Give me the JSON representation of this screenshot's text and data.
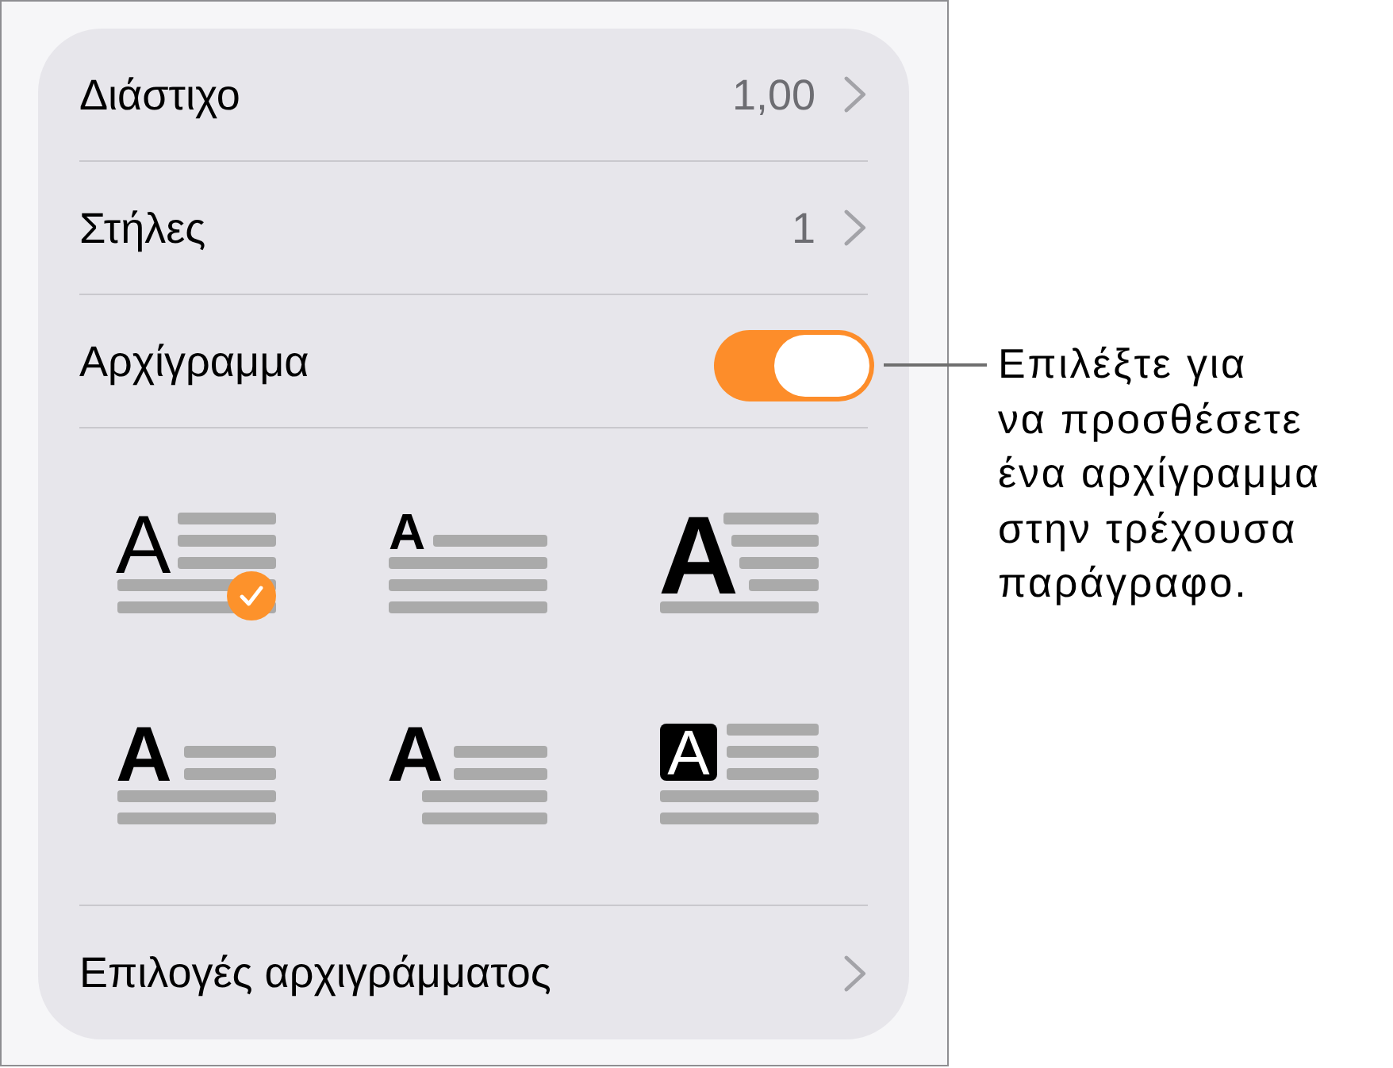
{
  "rows": [
    {
      "label": "Διάστιχο",
      "value": "1,00"
    },
    {
      "label": "Στήλες",
      "value": "1"
    }
  ],
  "drop_cap": {
    "label": "Αρχίγραμμα",
    "on": true
  },
  "drop_cap_styles": [
    {
      "kind": "thin",
      "letter": "A",
      "selected": true
    },
    {
      "kind": "raised",
      "letter": "A",
      "selected": false
    },
    {
      "kind": "tall",
      "letter": "A",
      "selected": false
    },
    {
      "kind": "bold",
      "letter": "A",
      "selected": false
    },
    {
      "kind": "hanging",
      "letter": "A",
      "selected": false
    },
    {
      "kind": "boxed",
      "letter": "A",
      "selected": false
    }
  ],
  "options_row": {
    "label": "Επιλογές αρχιγράμματος"
  },
  "callout": {
    "lines": [
      "Επιλέξτε για",
      "να προσθέσετε",
      "ένα αρχίγραμμα",
      "στην τρέχουσα",
      "παράγραφο."
    ]
  }
}
